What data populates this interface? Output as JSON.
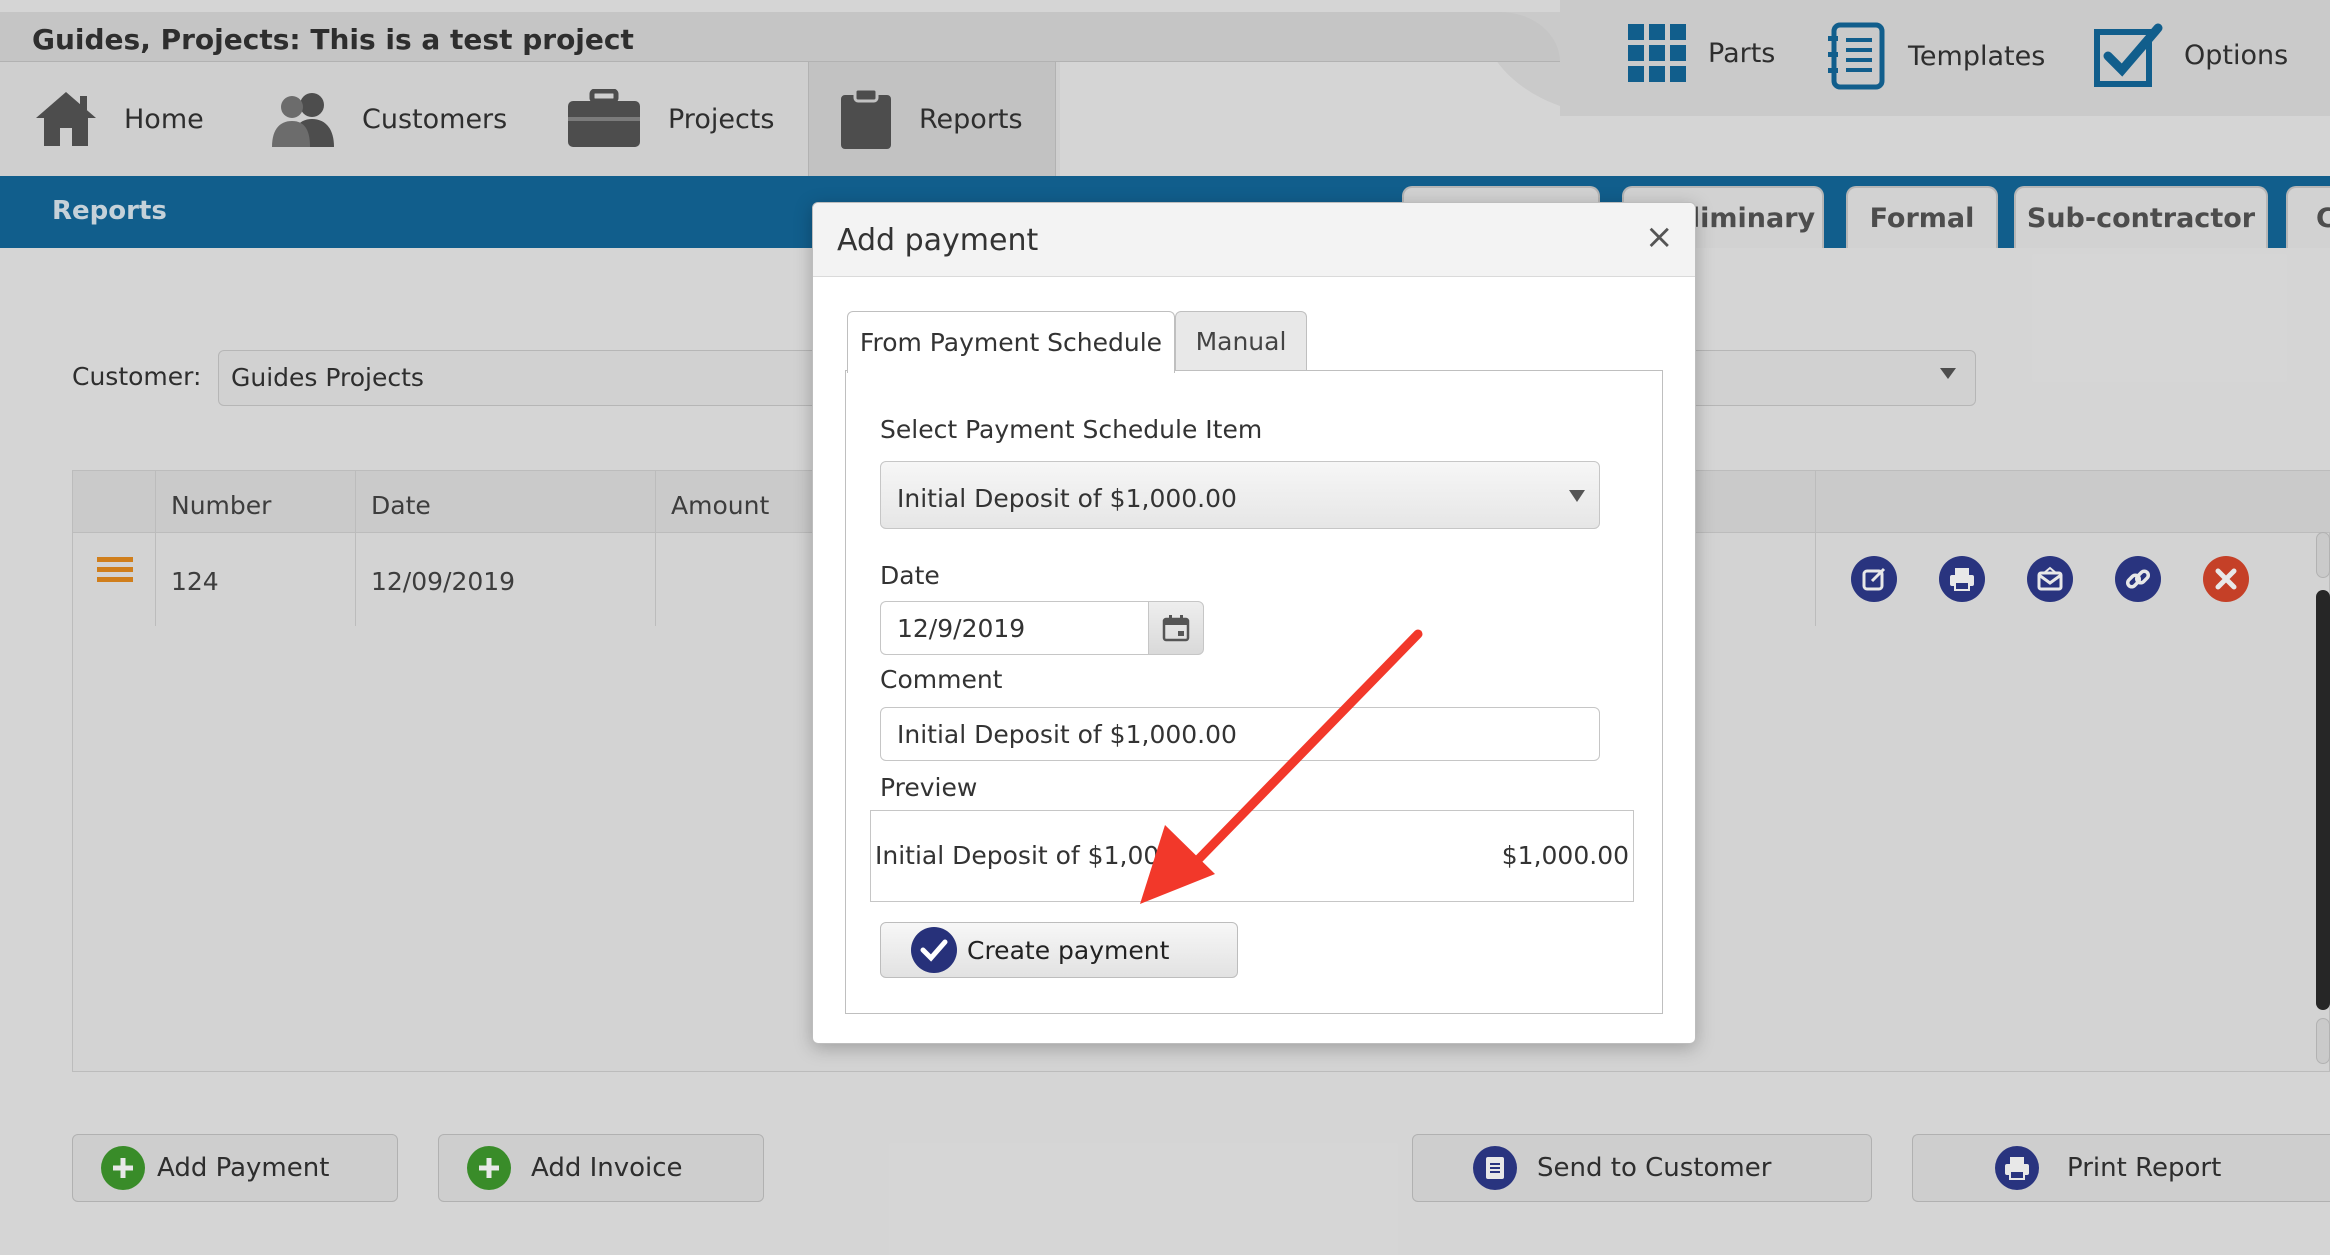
{
  "project_title": "Guides, Projects: This is a test project",
  "tools": [
    {
      "label": "Parts",
      "icon": "grid-icon"
    },
    {
      "label": "Templates",
      "icon": "notebook-icon"
    },
    {
      "label": "Options",
      "icon": "checkbox-icon"
    }
  ],
  "nav": [
    {
      "label": "Home",
      "icon": "home-icon"
    },
    {
      "label": "Customers",
      "icon": "users-icon"
    },
    {
      "label": "Projects",
      "icon": "briefcase-icon"
    },
    {
      "label": "Reports",
      "icon": "clipboard-icon",
      "active": true
    }
  ],
  "breadcrumb": "Reports",
  "report_tabs": [
    "liminary",
    "Formal",
    "Sub-contractor",
    "C"
  ],
  "customer": {
    "label": "Customer:",
    "value": "Guides Projects"
  },
  "grid": {
    "headers": [
      "Number",
      "Date",
      "Amount"
    ],
    "rows": [
      {
        "number": "124",
        "date": "12/09/2019"
      }
    ]
  },
  "bottom_buttons": {
    "add_payment": "Add Payment",
    "add_invoice": "Add Invoice",
    "send_to_customer": "Send to Customer",
    "print_report": "Print Report"
  },
  "modal": {
    "title": "Add payment",
    "close": "×",
    "tabs": [
      "From Payment Schedule",
      "Manual"
    ],
    "schedule_label": "Select Payment Schedule Item",
    "schedule_value": "Initial Deposit of $1,000.00",
    "date_label": "Date",
    "date_value": "12/9/2019",
    "comment_label": "Comment",
    "comment_value": "Initial Deposit of $1,000.00",
    "preview_label": "Preview",
    "preview_text": "Initial Deposit of $1,000",
    "preview_amount": "$1,000.00",
    "create_button": "Create payment"
  },
  "colors": {
    "blue_bar": "#13689a",
    "icon_navy": "#2e3a8c",
    "delete_red": "#d9472b",
    "menu_orange": "#e58b1e",
    "add_green": "#3f9a2e",
    "annotation_arrow": "#f2382a"
  }
}
